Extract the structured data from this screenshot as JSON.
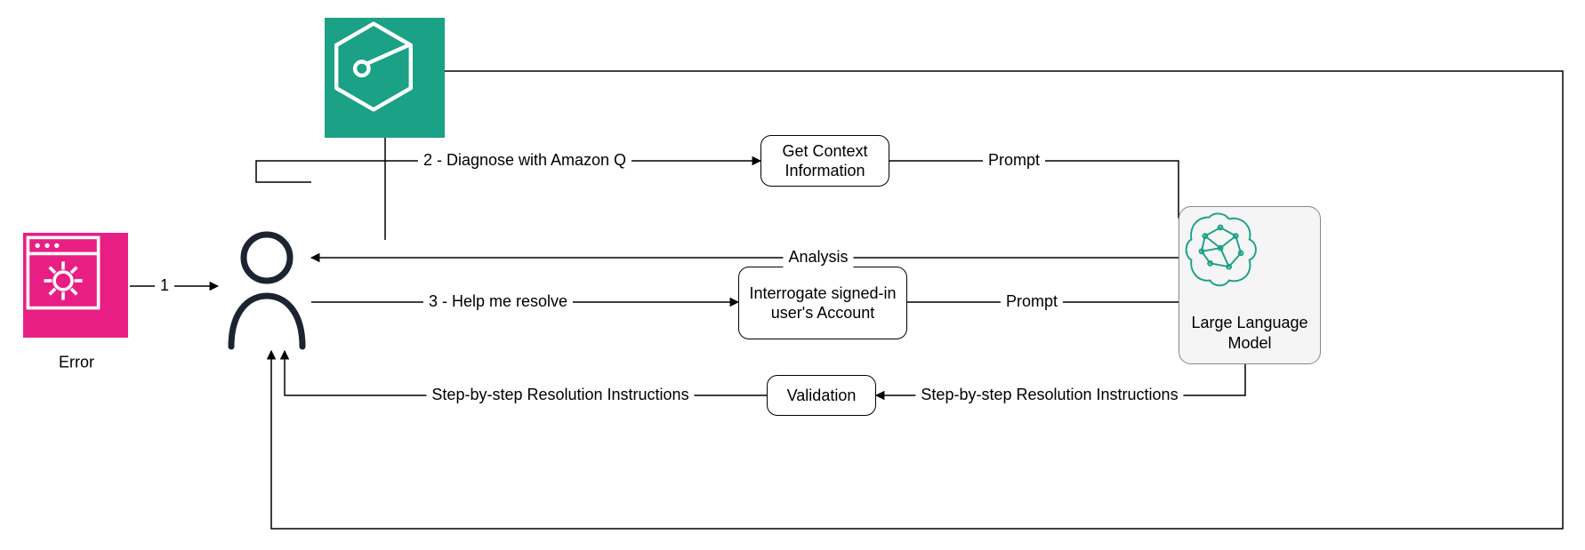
{
  "nodes": {
    "error_label": "Error",
    "get_context": "Get Context Information",
    "interrogate": "Interrogate signed-in user's Account",
    "validation": "Validation",
    "llm": "Large Language Model"
  },
  "edges": {
    "one": "1",
    "diagnose": "2 - Diagnose with Amazon Q",
    "help_resolve": "3 - Help me resolve",
    "prompt1": "Prompt",
    "prompt2": "Prompt",
    "analysis": "Analysis",
    "resolution_left": "Step-by-step Resolution Instructions",
    "resolution_right": "Step-by-step Resolution Instructions"
  },
  "colors": {
    "error_tile": "#e91e84",
    "service_tile": "#1ba185",
    "llm_accent": "#1ba185"
  }
}
